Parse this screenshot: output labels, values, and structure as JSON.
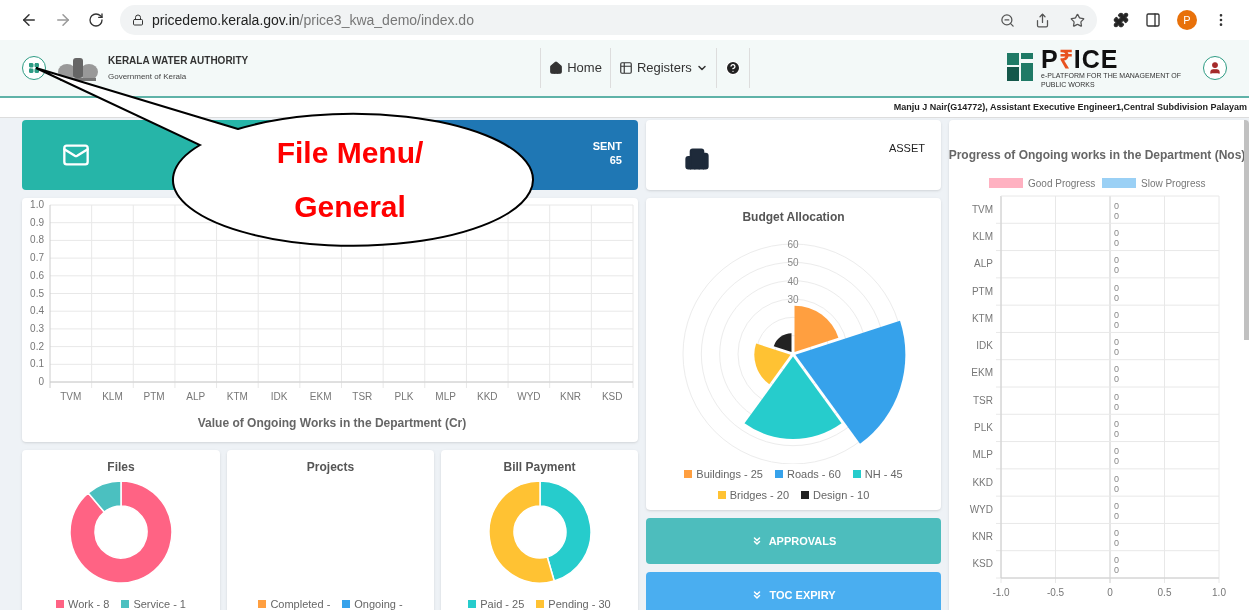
{
  "browser": {
    "url_host": "pricedemo.kerala.gov.in",
    "url_path": "/price3_kwa_demo/index.do",
    "profile_initial": "P"
  },
  "header": {
    "org_name": "KERALA WATER AUTHORITY",
    "org_subtitle": "Government of Kerala",
    "nav": [
      {
        "kind": "home",
        "label": "Home"
      },
      {
        "kind": "dropdown",
        "label": "Registers"
      },
      {
        "kind": "help"
      }
    ],
    "logo": {
      "parts": [
        {
          "text": "P",
          "accent": false
        },
        {
          "text": "₹",
          "accent": true
        },
        {
          "text": "ICE",
          "accent": false
        }
      ],
      "tagline": "e-PLATFORM FOR THE MANAGEMENT OF PUBLIC WORKS"
    }
  },
  "user_info": "Manju J Nair(G14772), Assistant Executive Engineer1,Central Subdivision Palayam",
  "summary_cards": [
    {
      "kind": "mail"
    },
    {
      "kind": "sent",
      "label": "SENT",
      "count": "65"
    }
  ],
  "asset_card": {
    "label": "ASSET"
  },
  "works_chart": {
    "chart_data": {
      "type": "line",
      "xlabel": "Value of Ongoing Works in the Department (Cr)",
      "categories": [
        "TVM",
        "KLM",
        "PTM",
        "ALP",
        "KTM",
        "IDK",
        "EKM",
        "TSR",
        "PLK",
        "MLP",
        "KKD",
        "WYD",
        "KNR",
        "KSD"
      ],
      "ylim": [
        0,
        1
      ],
      "yticks": [
        0,
        0.1,
        0.2,
        0.3,
        0.4,
        0.5,
        0.6,
        0.7,
        0.8,
        0.9,
        {
          "value": 1,
          "label": "1.0"
        }
      ],
      "grid": true
    }
  },
  "donut_cards": [
    {
      "title": "Files",
      "chart_data": {
        "type": "donut",
        "categories": [
          "Work - 8",
          "Service - 1"
        ],
        "values": [
          88.9,
          11.1
        ]
      },
      "legend": [
        {
          "color": "#ff6384"
        },
        {
          "color": "#4bc0c0"
        }
      ]
    },
    {
      "title": "Projects",
      "legend": [
        {
          "label": "Completed -",
          "color": "#ff9f40"
        },
        {
          "label": "Ongoing -",
          "color": "#36a2eb"
        }
      ]
    },
    {
      "title": "Bill Payment",
      "chart_data": {
        "type": "donut",
        "categories": [
          "Paid - 25",
          "Pending - 30"
        ],
        "values": [
          45.5,
          54.5
        ]
      },
      "legend": [
        {
          "color": "#26cccc"
        },
        {
          "color": "#ffc233"
        }
      ]
    }
  ],
  "budget": {
    "title": "Budget Allocation",
    "scale_labels": [
      "60",
      "50",
      "40",
      "30"
    ],
    "legend": [
      {
        "label": "Buildings - 25",
        "color": "#ff9f40"
      },
      {
        "label": "Roads - 60",
        "color": "#36a2eb"
      },
      {
        "label": "NH - 45",
        "color": "#26cccc"
      },
      {
        "label": "Bridges - 20",
        "color": "#ffc233"
      },
      {
        "label": "Design - 10",
        "color": "#222222"
      }
    ]
  },
  "actions": [
    {
      "label": "APPROVALS",
      "color": "#4dbdbd"
    },
    {
      "label": "TOC EXPIRY",
      "color": "#4aaef0"
    }
  ],
  "progress_chart": {
    "chart_data": {
      "type": "bar",
      "orientation": "horizontal",
      "title": "Progress of Ongoing works in the Department (Nos)",
      "categories": [
        "TVM",
        "KLM",
        "ALP",
        "PTM",
        "KTM",
        "IDK",
        "EKM",
        "TSR",
        "PLK",
        "MLP",
        "KKD",
        "WYD",
        "KNR",
        "KSD"
      ],
      "series": [
        {
          "name": "Good Progress",
          "color": "#ffb1c1",
          "values": [
            0,
            0,
            0,
            0,
            0,
            0,
            0,
            0,
            0,
            0,
            0,
            0,
            0,
            0
          ]
        },
        {
          "name": "Slow Progress",
          "color": "#9ad0f5",
          "values": [
            0,
            0,
            0,
            0,
            0,
            0,
            0,
            0,
            0,
            0,
            0,
            0,
            0,
            0
          ]
        }
      ],
      "xlim": [
        -1,
        1
      ],
      "xticks": [
        {
          "value": -1,
          "label": "-1.0"
        },
        {
          "value": -0.5,
          "label": "-0.5"
        },
        0,
        {
          "value": 0.5,
          "label": "0.5"
        },
        {
          "value": 1,
          "label": "1.0"
        }
      ],
      "data_labels": true
    }
  },
  "callout": {
    "text": "File Menu/\nGeneral"
  }
}
